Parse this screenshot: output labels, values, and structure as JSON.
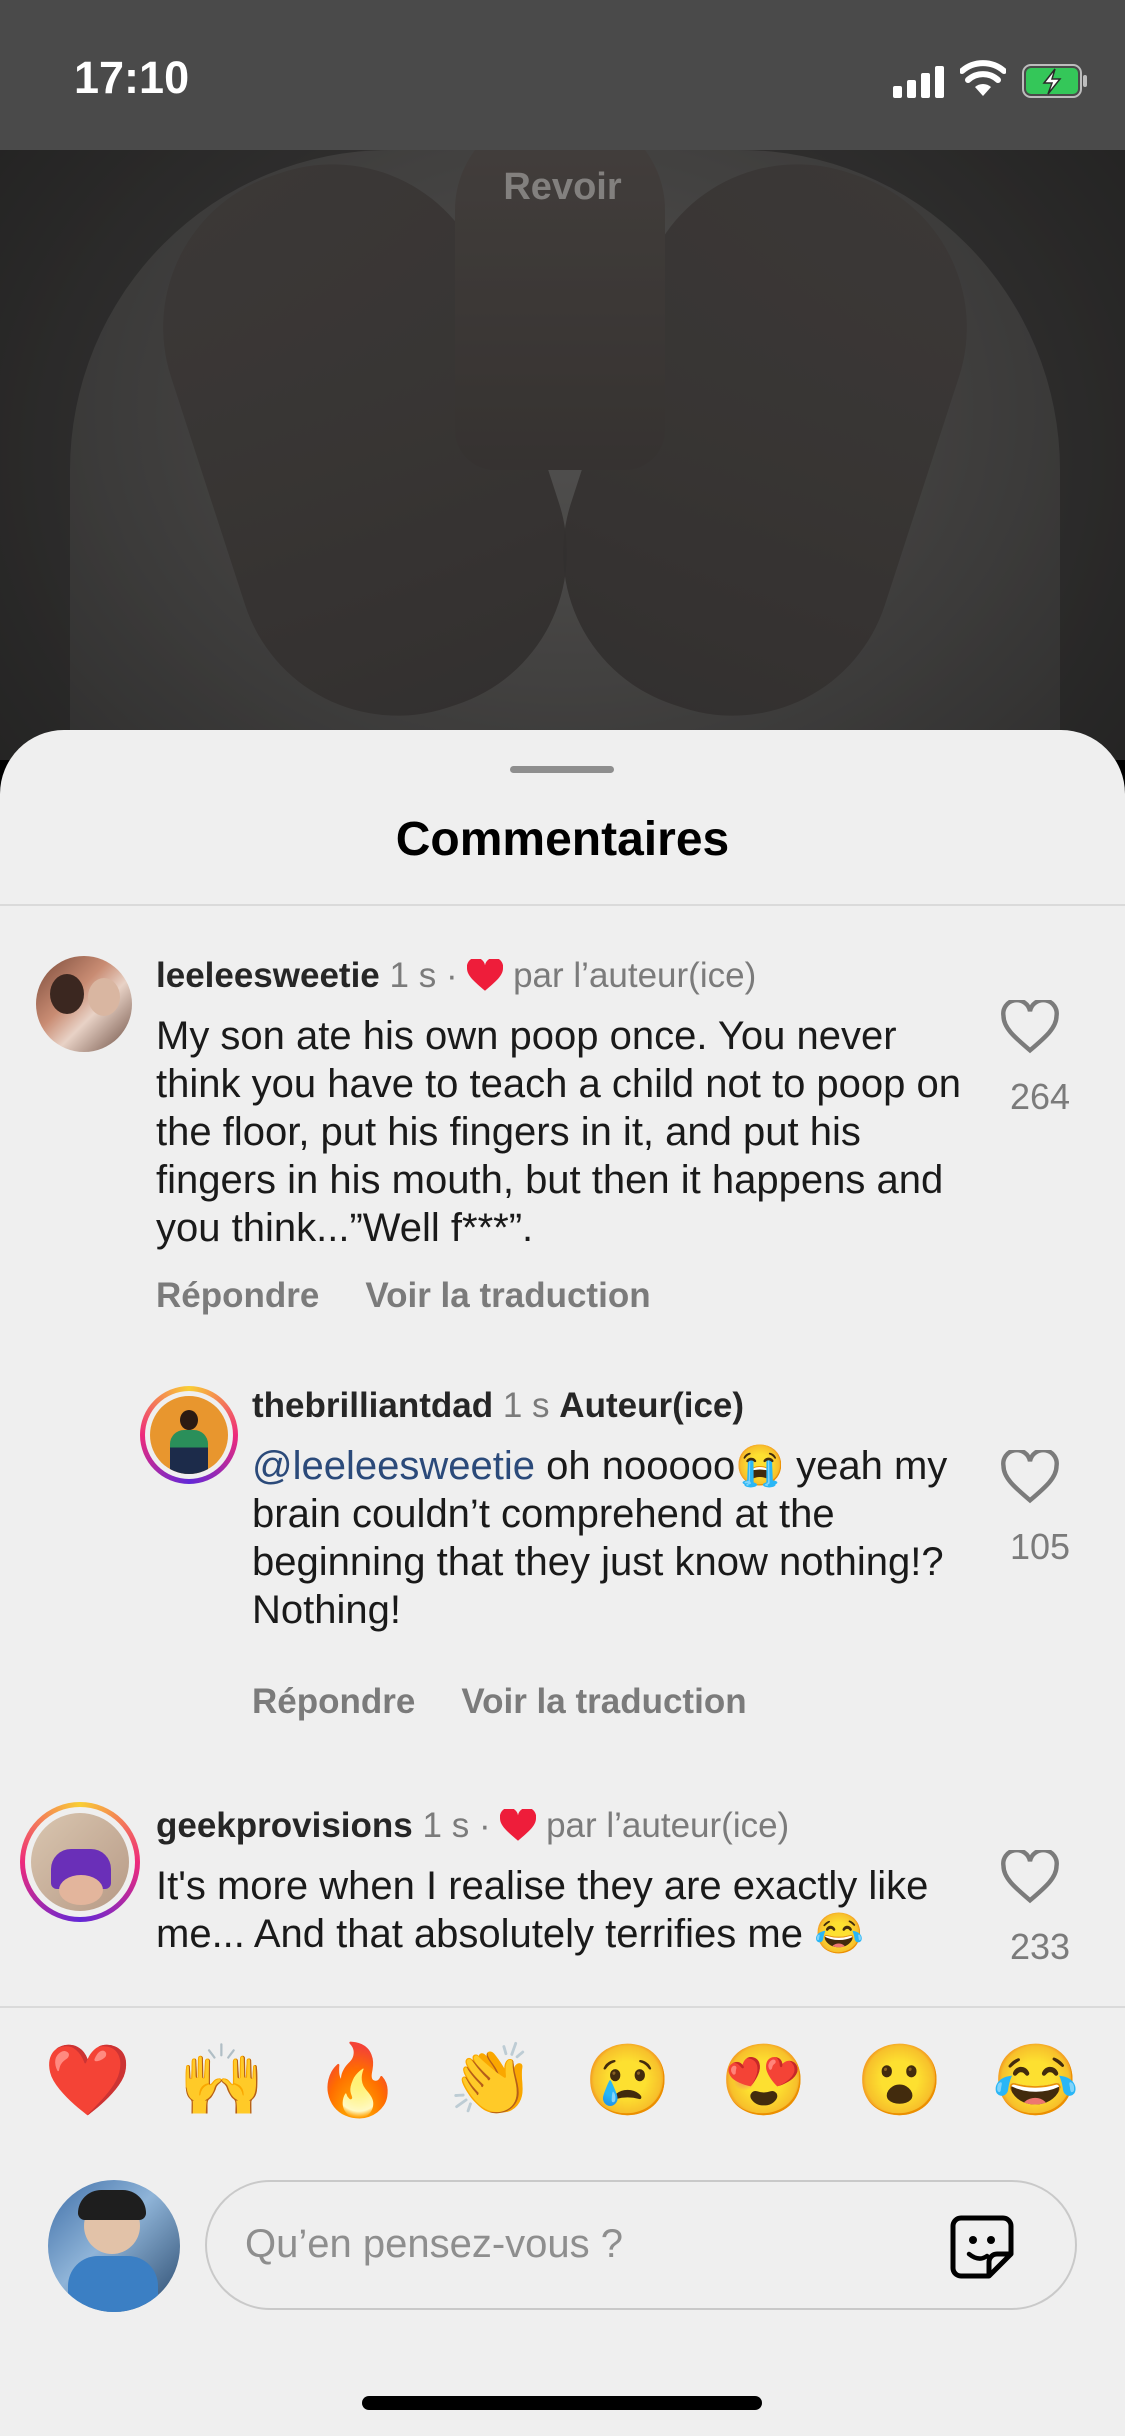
{
  "status_bar": {
    "time": "17:10"
  },
  "video": {
    "replay_label": "Revoir"
  },
  "sheet": {
    "title": "Commentaires"
  },
  "comments": [
    {
      "username": "leeleesweetie",
      "time": "1 s",
      "sep": "·",
      "liked_by_author": "par l’auteur(ice)",
      "text": "My son ate his own poop once. You never think you have to teach a child not to poop on the floor, put his fingers in it, and put his fingers in his mouth, but then it happens and you think...”Well f***”.",
      "reply_label": "Répondre",
      "translate_label": "Voir la traduction",
      "likes": "264"
    },
    {
      "username": "thebrilliantdad",
      "time": "1 s",
      "author_badge": "Auteur(ice)",
      "mention": "@leeleesweetie",
      "text": " oh nooooo😭 yeah my brain couldn’t comprehend at the beginning that they just know nothing!? Nothing!",
      "reply_label": "Répondre",
      "translate_label": "Voir la traduction",
      "likes": "105"
    },
    {
      "username": "geekprovisions",
      "time": "1 s",
      "sep": "·",
      "liked_by_author": "par l’auteur(ice)",
      "text": "It's more when I realise they are exactly like me... And that absolutely terrifies me 😂",
      "likes": "233"
    }
  ],
  "quick_reactions": [
    "❤️",
    "🙌",
    "🔥",
    "👏",
    "😢",
    "😍",
    "😮",
    "😂"
  ],
  "composer": {
    "placeholder": "Qu’en pensez-vous ?"
  },
  "colors": {
    "heart_red": "#ee1d3a",
    "sheet_bg": "#efefef"
  }
}
